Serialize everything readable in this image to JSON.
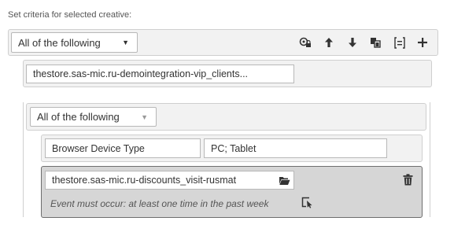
{
  "header": {
    "label": "Set criteria for selected creative:"
  },
  "top_group": {
    "select_value": "All of the following",
    "toolbar_icons": [
      "dependency-icon",
      "move-up-icon",
      "move-down-icon",
      "copy-icon",
      "list-icon",
      "add-icon"
    ]
  },
  "criteria_row_1": {
    "value": "thestore.sas-mic.ru-demointegration-vip_clients..."
  },
  "nested_group": {
    "select_value": "All of the following",
    "row_browser": {
      "attribute": "Browser Device Type",
      "value": "PC; Tablet"
    },
    "row_event": {
      "value": "thestore.sas-mic.ru-discounts_visit-rusmat",
      "note": "Event must occur: at least one time in the past week"
    }
  }
}
